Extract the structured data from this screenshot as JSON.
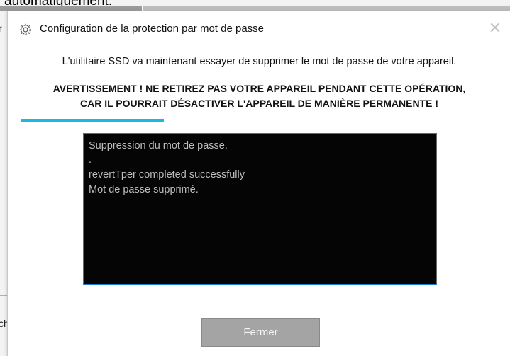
{
  "background": {
    "top_text": "automatiquement.",
    "left_fragment_1": "r",
    "left_fragment_2": "ch"
  },
  "dialog": {
    "title": "Configuration de la protection par mot de passe",
    "title_icon": "gear-icon",
    "close_icon": "close-icon",
    "message": "L'utilitaire SSD va maintenant essayer de supprimer le mot de passe de votre appareil.",
    "warning_line1": "AVERTISSEMENT ! NE RETIREZ PAS VOTRE APPAREIL PENDANT CETTE OPÉRATION,",
    "warning_line2": "CAR IL POURRAIT DÉSACTIVER L'APPAREIL DE MANIÈRE PERMANENTE !",
    "progress_fraction": 0.3,
    "progress_color": "#1ab7de",
    "console_lines": [
      "Suppression du mot de passe.",
      ".",
      "revertTper completed successfully",
      "Mot de passe supprimé."
    ],
    "button_label": "Fermer"
  }
}
